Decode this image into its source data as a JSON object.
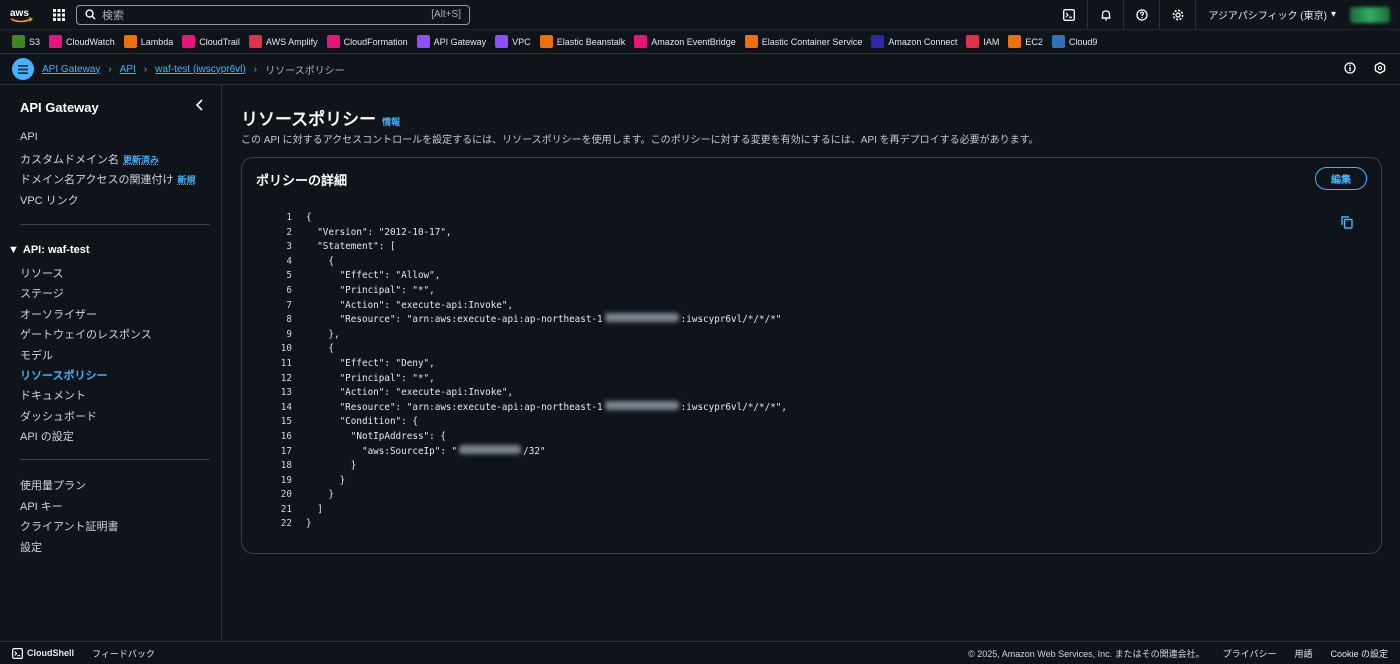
{
  "topnav": {
    "logo": "aws",
    "search_placeholder": "検索",
    "search_shortcut": "[Alt+S]",
    "region": "アジアパシフィック (東京)",
    "icons": [
      "cloudshell-icon",
      "bell-icon",
      "help-icon",
      "settings-icon"
    ]
  },
  "favorites": [
    {
      "label": "S3",
      "color": "#3f8624"
    },
    {
      "label": "CloudWatch",
      "color": "#e7157b"
    },
    {
      "label": "Lambda",
      "color": "#ed7100"
    },
    {
      "label": "CloudTrail",
      "color": "#e7157b"
    },
    {
      "label": "AWS Amplify",
      "color": "#dd344c"
    },
    {
      "label": "CloudFormation",
      "color": "#e7157b"
    },
    {
      "label": "API Gateway",
      "color": "#8c4fff"
    },
    {
      "label": "VPC",
      "color": "#8c4fff"
    },
    {
      "label": "Elastic Beanstalk",
      "color": "#ed7100"
    },
    {
      "label": "Amazon EventBridge",
      "color": "#e7157b"
    },
    {
      "label": "Elastic Container Service",
      "color": "#ed7100"
    },
    {
      "label": "Amazon Connect",
      "color": "#2e27ad"
    },
    {
      "label": "IAM",
      "color": "#dd344c"
    },
    {
      "label": "EC2",
      "color": "#ed7100"
    },
    {
      "label": "Cloud9",
      "color": "#2e73b8"
    }
  ],
  "breadcrumb": {
    "items": [
      "API Gateway",
      "API",
      "waf-test (iwscypr6vl)"
    ],
    "current": "リソースポリシー"
  },
  "sidebar": {
    "title": "API Gateway",
    "top_items": [
      {
        "label": "API",
        "badge": ""
      },
      {
        "label": "カスタムドメイン名",
        "badge": "更新済み"
      },
      {
        "label": "ドメイン名アクセスの関連付け",
        "badge": "新規"
      },
      {
        "label": "VPC リンク",
        "badge": ""
      }
    ],
    "section_title": "API: waf-test",
    "section_items": [
      "リソース",
      "ステージ",
      "オーソライザー",
      "ゲートウェイのレスポンス",
      "モデル",
      "リソースポリシー",
      "ドキュメント",
      "ダッシュボード",
      "API の設定"
    ],
    "active_item": "リソースポリシー",
    "bottom_items": [
      "使用量プラン",
      "API キー",
      "クライアント証明書",
      "設定"
    ]
  },
  "main": {
    "title": "リソースポリシー",
    "info_link": "情報",
    "description": "この API に対するアクセスコントロールを設定するには、リソースポリシーを使用します。このポリシーに対する変更を有効にするには、API を再デプロイする必要があります。",
    "card_title": "ポリシーの詳細",
    "edit_label": "編集",
    "code_lines": [
      {
        "n": "1",
        "text": "{"
      },
      {
        "n": "2",
        "text": "  \"Version\": \"2012-10-17\","
      },
      {
        "n": "3",
        "text": "  \"Statement\": ["
      },
      {
        "n": "4",
        "text": "    {"
      },
      {
        "n": "5",
        "text": "      \"Effect\": \"Allow\","
      },
      {
        "n": "6",
        "text": "      \"Principal\": \"*\","
      },
      {
        "n": "7",
        "text": "      \"Action\": \"execute-api:Invoke\","
      },
      {
        "n": "8",
        "text": "      \"Resource\": \"arn:aws:execute-api:ap-northeast-1",
        "redact": 74,
        "after": ":iwscypr6vl/*/*/*\""
      },
      {
        "n": "9",
        "text": "    },"
      },
      {
        "n": "10",
        "text": "    {"
      },
      {
        "n": "11",
        "text": "      \"Effect\": \"Deny\","
      },
      {
        "n": "12",
        "text": "      \"Principal\": \"*\","
      },
      {
        "n": "13",
        "text": "      \"Action\": \"execute-api:Invoke\","
      },
      {
        "n": "14",
        "text": "      \"Resource\": \"arn:aws:execute-api:ap-northeast-1",
        "redact": 74,
        "after": ":iwscypr6vl/*/*/*\","
      },
      {
        "n": "15",
        "text": "      \"Condition\": {"
      },
      {
        "n": "16",
        "text": "        \"NotIpAddress\": {"
      },
      {
        "n": "17",
        "text": "          \"aws:SourceIp\": \"",
        "redact": 62,
        "after": "/32\""
      },
      {
        "n": "18",
        "text": "        }"
      },
      {
        "n": "19",
        "text": "      }"
      },
      {
        "n": "20",
        "text": "    }"
      },
      {
        "n": "21",
        "text": "  ]"
      },
      {
        "n": "22",
        "text": "}"
      }
    ]
  },
  "footer": {
    "cloudshell": "CloudShell",
    "feedback": "フィードバック",
    "copyright": "© 2025, Amazon Web Services, Inc. またはその関連会社。",
    "privacy": "プライバシー",
    "terms": "用語",
    "cookie": "Cookie の設定"
  }
}
